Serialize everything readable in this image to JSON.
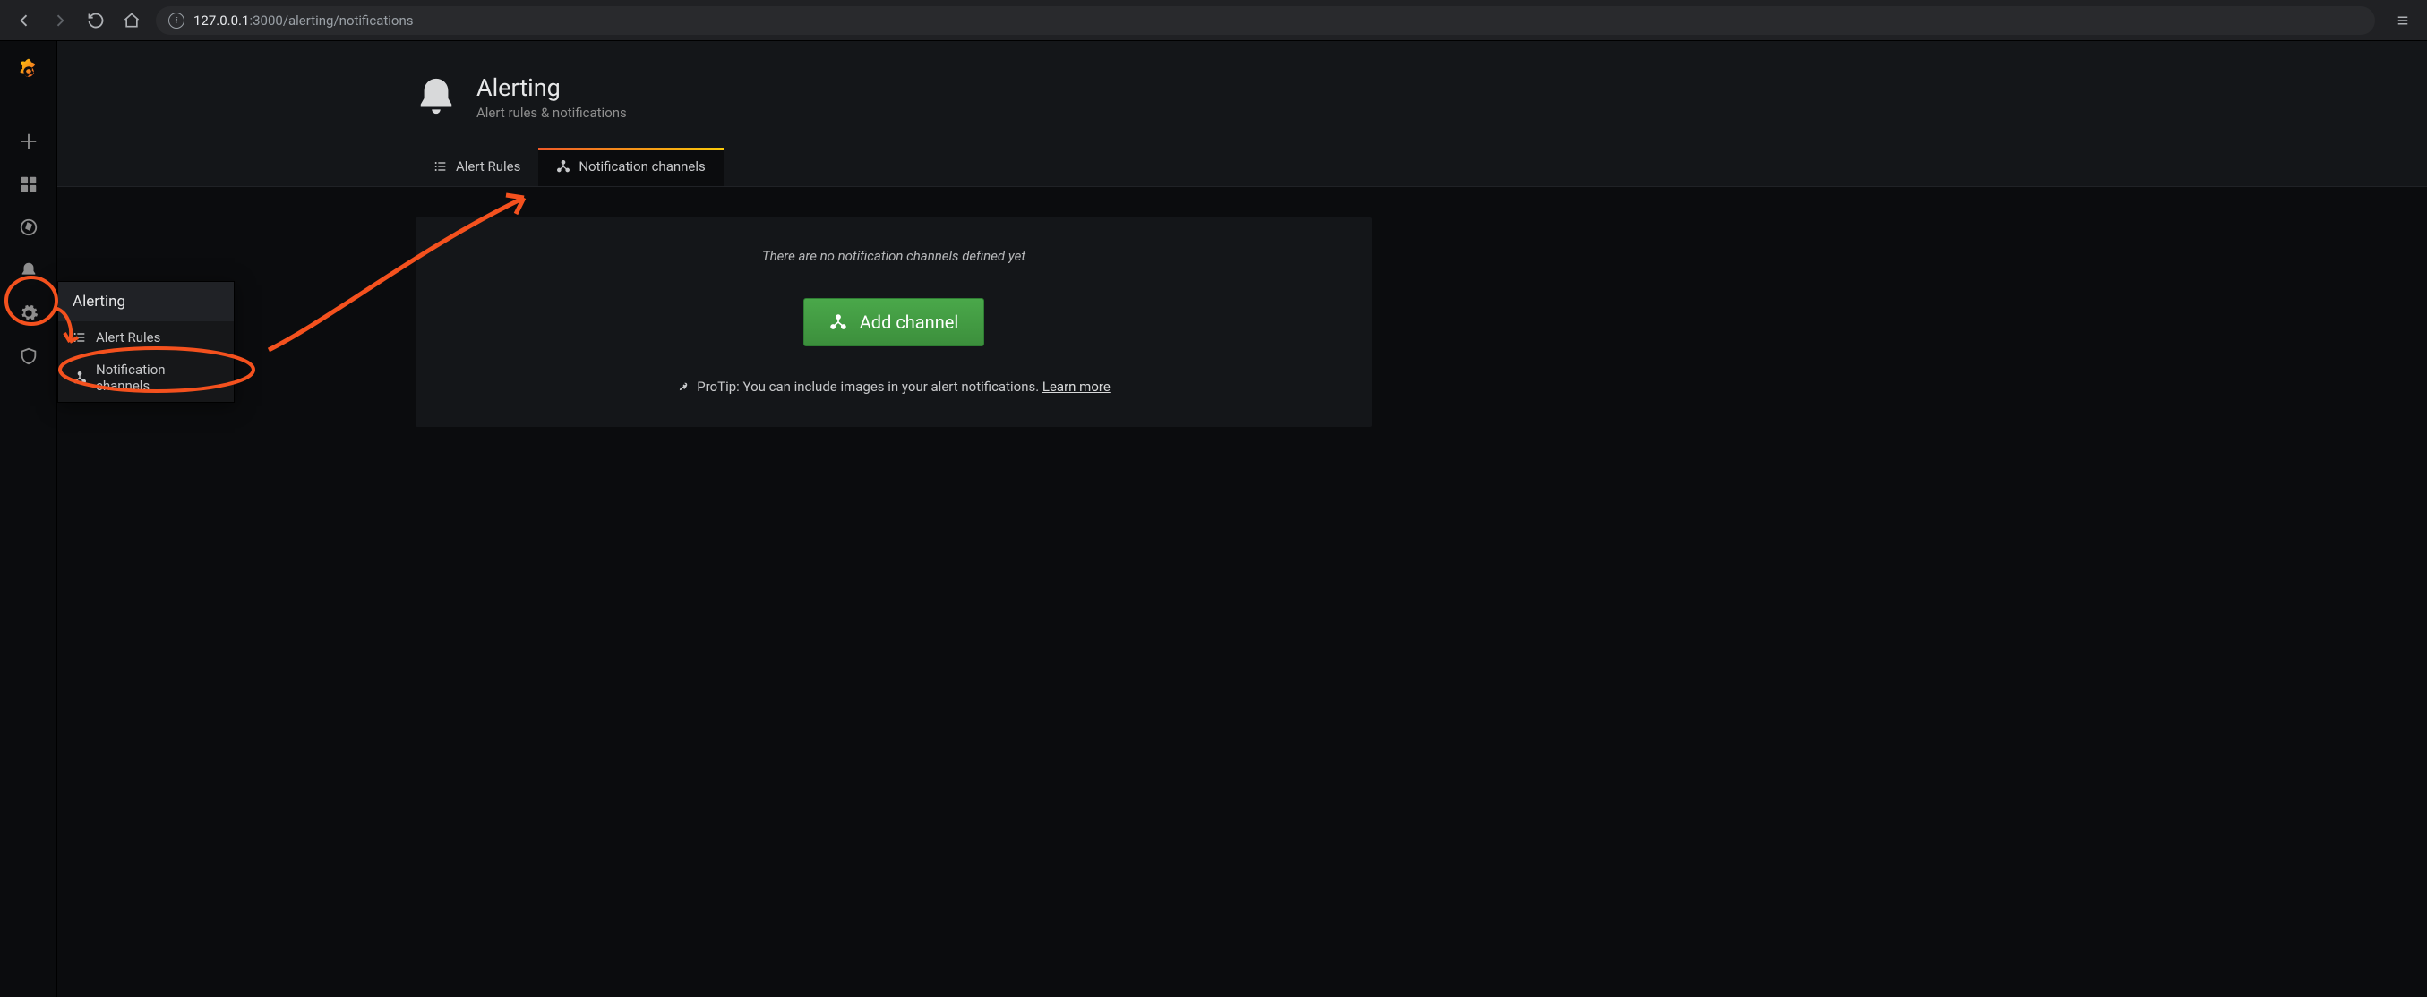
{
  "browser": {
    "url_host": "127.0.0.1",
    "url_port": ":3000",
    "url_path": "/alerting/notifications"
  },
  "sidenav": {
    "items": [
      {
        "name": "create"
      },
      {
        "name": "dashboards"
      },
      {
        "name": "explore"
      },
      {
        "name": "alerting"
      },
      {
        "name": "configuration"
      },
      {
        "name": "server-admin"
      }
    ]
  },
  "flyout": {
    "title": "Alerting",
    "items": [
      {
        "label": "Alert Rules"
      },
      {
        "label": "Notification channels"
      }
    ]
  },
  "page": {
    "title": "Alerting",
    "subtitle": "Alert rules & notifications",
    "tabs": [
      {
        "label": "Alert Rules",
        "active": false
      },
      {
        "label": "Notification channels",
        "active": true
      }
    ],
    "empty_message": "There are no notification channels defined yet",
    "add_button_label": "Add channel",
    "protip_prefix": "ProTip: You can include images in your alert notifications. ",
    "protip_link": "Learn more"
  },
  "colors": {
    "accent_gradient_start": "#f05a28",
    "accent_gradient_end": "#fbca0a",
    "button_green": "#3c8f3c",
    "annotation_red": "#f4511e"
  }
}
